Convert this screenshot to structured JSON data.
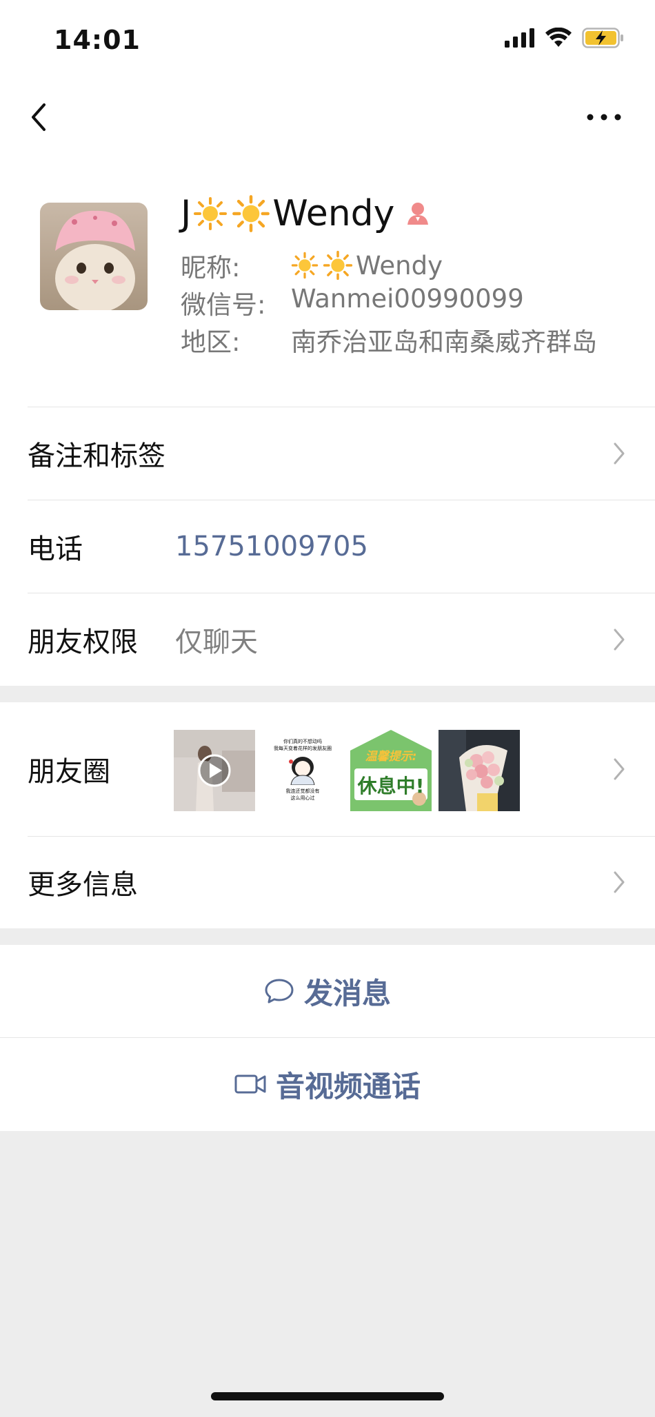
{
  "status_bar": {
    "time": "14:01"
  },
  "profile": {
    "display_name_prefix": "J",
    "display_name_suffix": "Wendy",
    "nickname_label": "昵称:",
    "nickname_value": "Wendy",
    "wechat_id_label": "微信号:",
    "wechat_id_value": "Wanmei00990099",
    "region_label": "地区:",
    "region_value": "南乔治亚岛和南桑威齐群岛"
  },
  "rows": {
    "remarks_tags": "备注和标签",
    "phone_label": "电话",
    "phone_value": "15751009705",
    "permissions_label": "朋友权限",
    "permissions_value": "仅聊天",
    "moments_label": "朋友圈",
    "more_info": "更多信息"
  },
  "moments_thumbs": [
    {
      "kind": "video"
    },
    {
      "kind": "meme",
      "lines": [
        "你们真的不想动吗",
        "我每天变着花样的发朋友圈",
        "我连还觉都没有",
        "这么用心过"
      ]
    },
    {
      "kind": "sign",
      "top_text": "温馨提示:",
      "main_text": "休息中!"
    },
    {
      "kind": "flowers"
    }
  ],
  "actions": {
    "send_message": "发消息",
    "video_call": "音视频通话"
  },
  "colors": {
    "link": "#576b95",
    "gender_female": "#f08a8a",
    "background": "#ededed"
  },
  "icons": [
    "back-icon",
    "more-icon",
    "chevron-right-icon",
    "message-icon",
    "video-icon",
    "gender-female-icon",
    "sun-emoji-icon"
  ]
}
